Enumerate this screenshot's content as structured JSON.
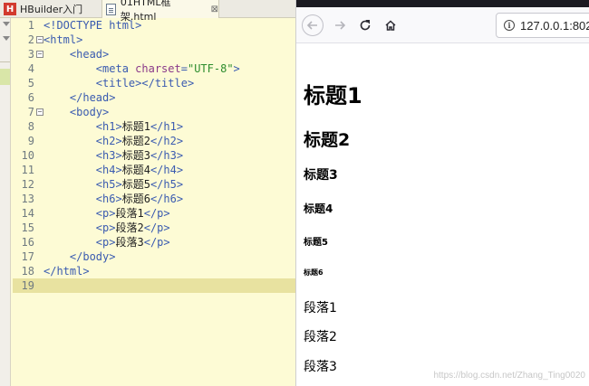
{
  "editor": {
    "tabs": [
      {
        "label": "HBuilder入门",
        "icon": "hbuilder-icon"
      },
      {
        "label": "01HTML框架.html",
        "icon": "html-file-icon",
        "close": "⊠"
      }
    ],
    "lines": [
      {
        "n": "1",
        "code": "<!DOCTYPE html>"
      },
      {
        "n": "2",
        "code": "<html>"
      },
      {
        "n": "3",
        "code": "    <head>"
      },
      {
        "n": "4",
        "code": "        <meta charset=\"UTF-8\">"
      },
      {
        "n": "5",
        "code": "        <title></title>"
      },
      {
        "n": "6",
        "code": "    </head>"
      },
      {
        "n": "7",
        "code": "    <body>"
      },
      {
        "n": "8",
        "code": "        <h1>标题1</h1>"
      },
      {
        "n": "9",
        "code": "        <h2>标题2</h2>"
      },
      {
        "n": "10",
        "code": "        <h3>标题3</h3>"
      },
      {
        "n": "11",
        "code": "        <h4>标题4</h4>"
      },
      {
        "n": "12",
        "code": "        <h5>标题5</h5>"
      },
      {
        "n": "13",
        "code": "        <h6>标题6</h6>"
      },
      {
        "n": "14",
        "code": "        <p>段落1</p>"
      },
      {
        "n": "15",
        "code": "        <p>段落2</p>"
      },
      {
        "n": "16",
        "code": "        <p>段落3</p>"
      },
      {
        "n": "17",
        "code": "    </body>"
      },
      {
        "n": "18",
        "code": "</html>"
      },
      {
        "n": "19",
        "code": ""
      }
    ]
  },
  "browser": {
    "url": "127.0.0.1:802",
    "info_icon_glyph": "i",
    "page": {
      "h1": "标题1",
      "h2": "标题2",
      "h3": "标题3",
      "h4": "标题4",
      "h5": "标题5",
      "h6": "标题6",
      "p1": "段落1",
      "p2": "段落2",
      "p3": "段落3"
    }
  },
  "watermark": "https://blog.csdn.net/Zhang_Ting0020",
  "colors": {
    "tag": "#3a5bb0",
    "attr": "#8a3a8a",
    "value": "#2d8c2d",
    "editor_bg": "#fdfbd5"
  }
}
